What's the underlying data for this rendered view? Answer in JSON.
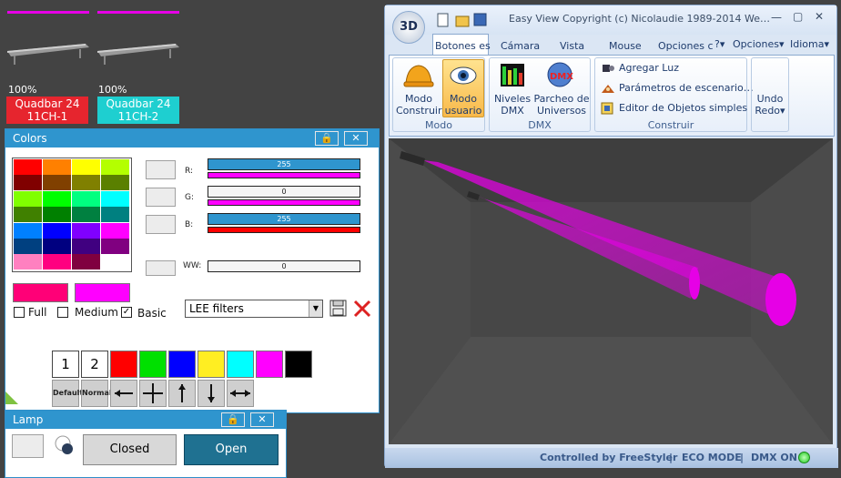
{
  "fixtures": [
    {
      "percent": "100%",
      "name": "Quadbar 24",
      "mode": "11CH-1",
      "label_color": "#e6252e"
    },
    {
      "percent": "100%",
      "name": "Quadbar 24",
      "mode": "11CH-2",
      "label_color": "#1ecfd0"
    }
  ],
  "colors_window": {
    "title": "Colors",
    "pin_icon": "lock-icon",
    "close_icon": "close-icon",
    "channels": [
      {
        "label": "R:",
        "value": "255",
        "strip_color": "#ff00ff"
      },
      {
        "label": "G:",
        "value": "0",
        "strip_color": "#ff00ff"
      },
      {
        "label": "B:",
        "value": "255",
        "strip_color": "#ff0000"
      },
      {
        "label": "WW:",
        "value": "0"
      }
    ],
    "grid_colors": [
      "#ff0000",
      "#ff8000",
      "#ffff00",
      "#b4ff00",
      "#800000",
      "#804000",
      "#808000",
      "#5a8000",
      "#80ff00",
      "#00ff00",
      "#00ff80",
      "#00ffff",
      "#408000",
      "#008000",
      "#008040",
      "#008080",
      "#0080ff",
      "#0000ff",
      "#8000ff",
      "#ff00ff",
      "#004080",
      "#000080",
      "#400080",
      "#800080",
      "#ff80c0",
      "#ff0080",
      "#800040",
      "#ffffff"
    ],
    "current_color_a": "#ff0077",
    "current_color_b": "#ff00ff",
    "checkboxes": [
      {
        "label": "Full",
        "checked": false
      },
      {
        "label": "Medium",
        "checked": false
      },
      {
        "label": "Basic",
        "checked": true
      }
    ],
    "filter_select": "LEE filters",
    "preset_buttons": [
      "1",
      "2"
    ],
    "palette": [
      "#ff0000",
      "#00e000",
      "#0000ff",
      "#ffee22",
      "#00ffff",
      "#ff00ff",
      "#000000"
    ],
    "bottom_buttons": [
      "Default",
      "Normal"
    ]
  },
  "lamp_window": {
    "title": "Lamp",
    "closed_label": "Closed",
    "open_label": "Open"
  },
  "view3d": {
    "title": "Easy View  Copyright (c) Nicolaudie 1989-2014  We…",
    "logo": "3D",
    "tabs": [
      "Botones es",
      "Cámara",
      "Vista",
      "Mouse",
      "Opciones c"
    ],
    "right_menus": [
      "?",
      "Opciones",
      "Idioma"
    ],
    "groups": {
      "modo": {
        "label": "Modo",
        "buttons": [
          {
            "line1": "Modo",
            "line2": "Construir"
          },
          {
            "line1": "Modo",
            "line2": "usuario"
          }
        ]
      },
      "dmx": {
        "label": "DMX",
        "buttons": [
          {
            "line1": "Niveles",
            "line2": "DMX"
          },
          {
            "line1": "Parcheo de",
            "line2": "Universos"
          }
        ]
      },
      "construir": {
        "label": "Construir",
        "items": [
          "Agregar Luz",
          "Parámetros de escenario…",
          "Editor de Objetos simples"
        ]
      },
      "undo": {
        "line1": "Undo",
        "line2": "Redo"
      }
    },
    "status": {
      "controlled": "Controlled by FreeStyler",
      "eco": "ECO MODE",
      "dmx": "DMX ON"
    },
    "beam_color": "#e600e6"
  }
}
